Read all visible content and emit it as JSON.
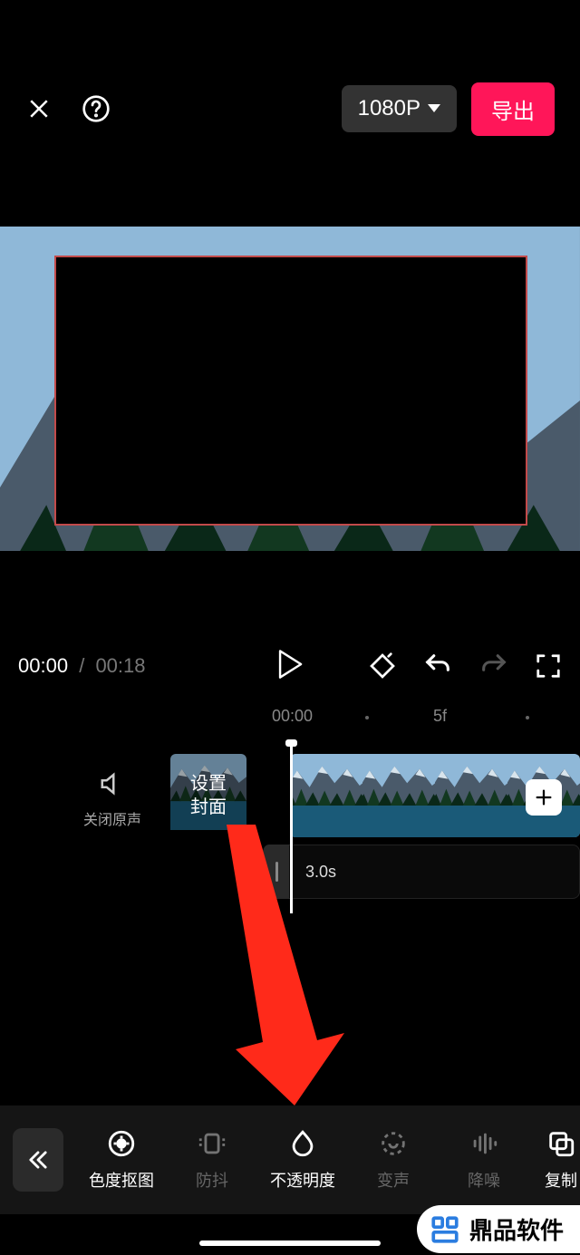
{
  "header": {
    "resolution": "1080P",
    "export": "导出"
  },
  "playback": {
    "current": "00:00",
    "total": "00:18",
    "sep": "/"
  },
  "ruler": {
    "m0": "00:00",
    "m1": "5f"
  },
  "tracks": {
    "mute_label": "关闭原声",
    "cover_label": "设置\n封面",
    "clip_duration": "3.0s"
  },
  "toolbar": {
    "items": [
      {
        "label": "色度抠图",
        "state": "normal"
      },
      {
        "label": "防抖",
        "state": "dim"
      },
      {
        "label": "不透明度",
        "state": "active"
      },
      {
        "label": "变声",
        "state": "dim"
      },
      {
        "label": "降噪",
        "state": "dim"
      },
      {
        "label": "复制",
        "state": "normal"
      }
    ]
  },
  "watermark": {
    "text": "鼎品软件"
  }
}
